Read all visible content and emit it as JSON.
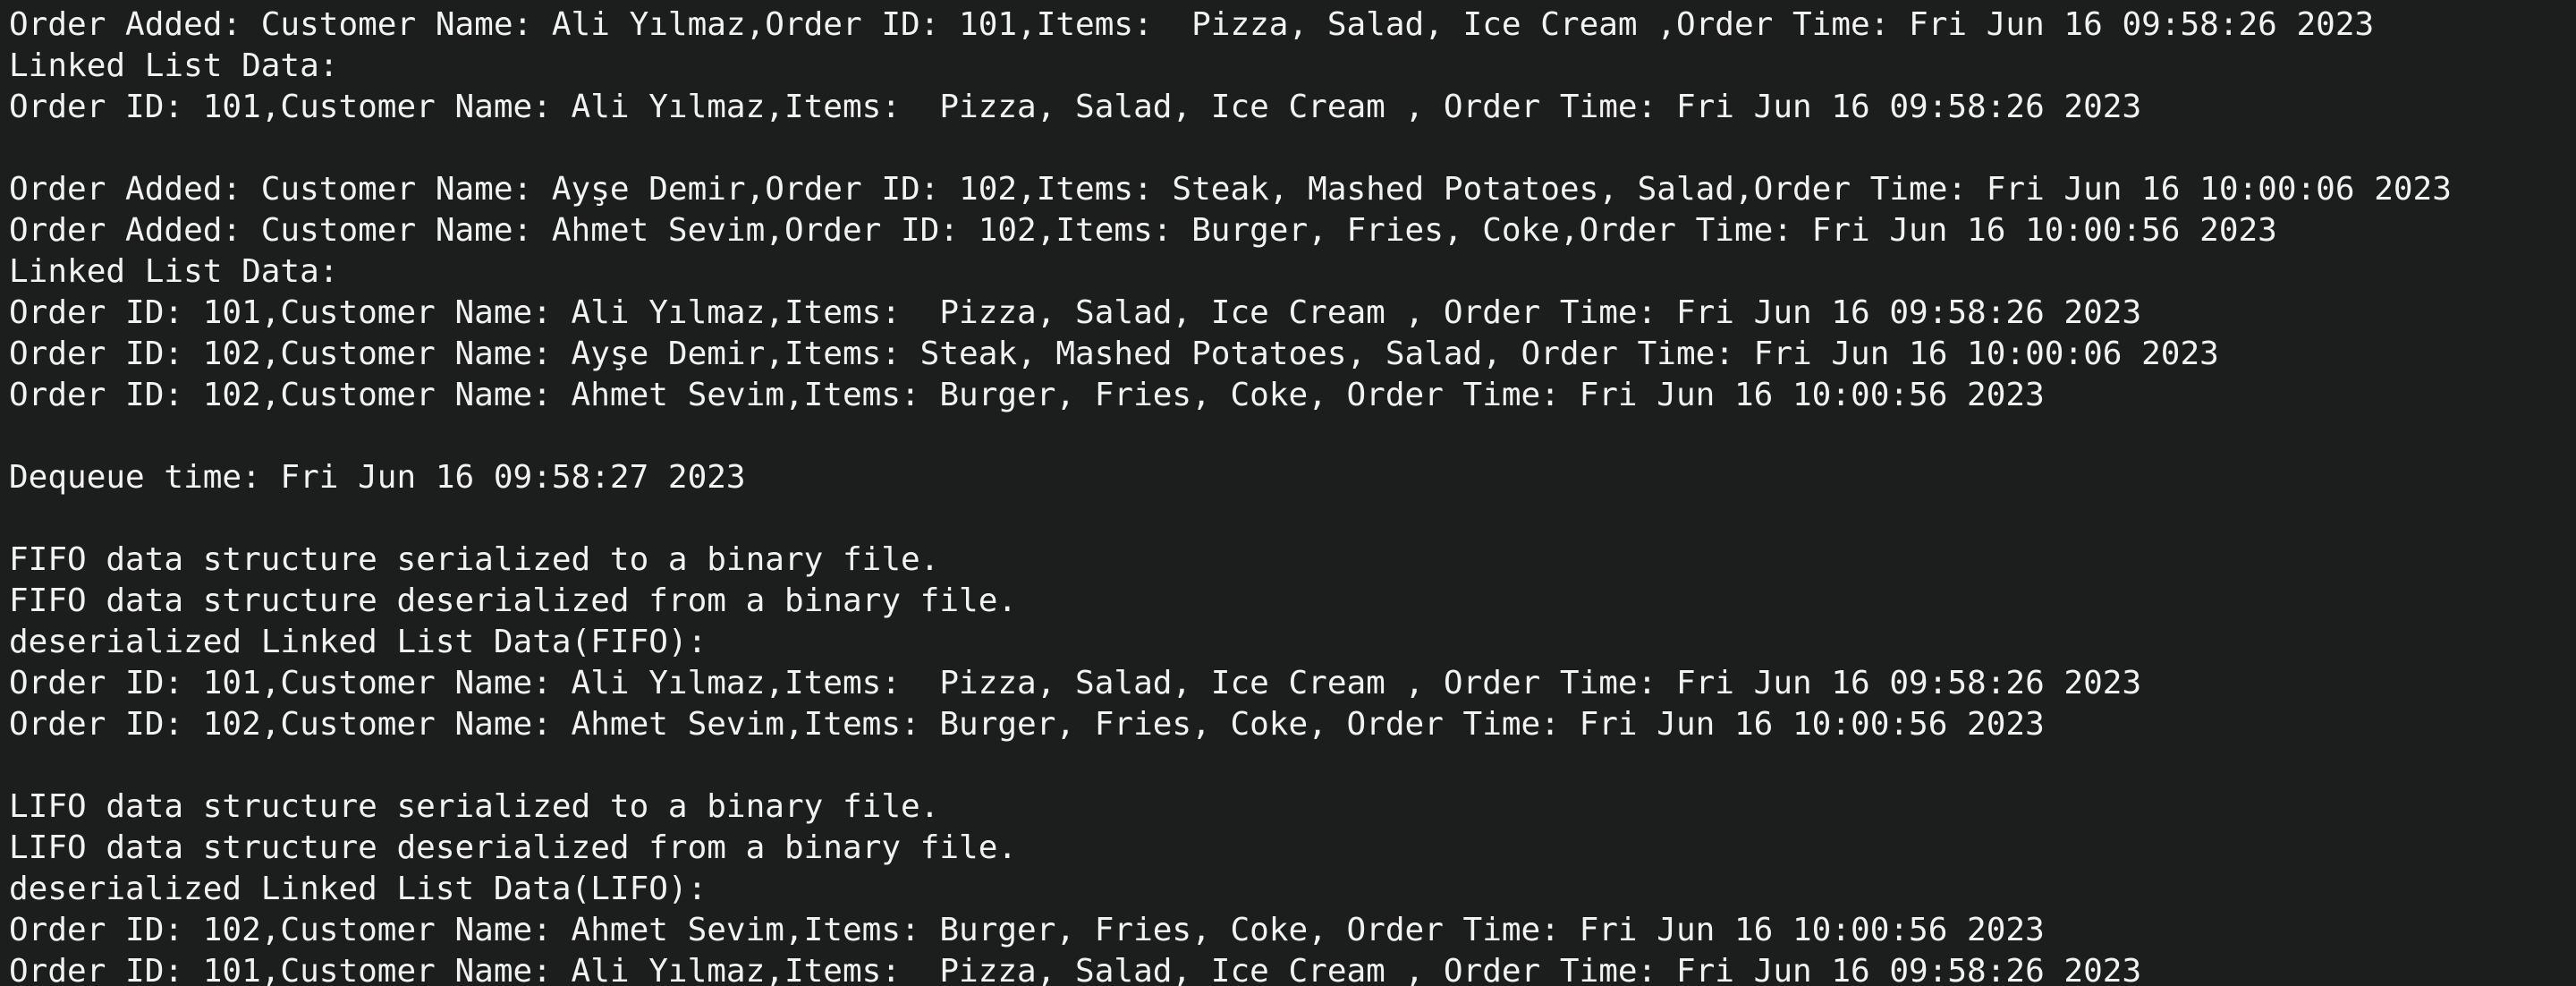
{
  "terminal": {
    "text_color": "#f2f2f2",
    "background_color": "#1c1e1d",
    "lines": [
      "Order Added: Customer Name: Ali Yılmaz,Order ID: 101,Items:  Pizza, Salad, Ice Cream ,Order Time: Fri Jun 16 09:58:26 2023",
      "Linked List Data:",
      "Order ID: 101,Customer Name: Ali Yılmaz,Items:  Pizza, Salad, Ice Cream , Order Time: Fri Jun 16 09:58:26 2023",
      "",
      "Order Added: Customer Name: Ayşe Demir,Order ID: 102,Items: Steak, Mashed Potatoes, Salad,Order Time: Fri Jun 16 10:00:06 2023",
      "Order Added: Customer Name: Ahmet Sevim,Order ID: 102,Items: Burger, Fries, Coke,Order Time: Fri Jun 16 10:00:56 2023",
      "Linked List Data:",
      "Order ID: 101,Customer Name: Ali Yılmaz,Items:  Pizza, Salad, Ice Cream , Order Time: Fri Jun 16 09:58:26 2023",
      "Order ID: 102,Customer Name: Ayşe Demir,Items: Steak, Mashed Potatoes, Salad, Order Time: Fri Jun 16 10:00:06 2023",
      "Order ID: 102,Customer Name: Ahmet Sevim,Items: Burger, Fries, Coke, Order Time: Fri Jun 16 10:00:56 2023",
      "",
      "Dequeue time: Fri Jun 16 09:58:27 2023",
      "",
      "FIFO data structure serialized to a binary file.",
      "FIFO data structure deserialized from a binary file.",
      "deserialized Linked List Data(FIFO):",
      "Order ID: 101,Customer Name: Ali Yılmaz,Items:  Pizza, Salad, Ice Cream , Order Time: Fri Jun 16 09:58:26 2023",
      "Order ID: 102,Customer Name: Ahmet Sevim,Items: Burger, Fries, Coke, Order Time: Fri Jun 16 10:00:56 2023",
      "",
      "LIFO data structure serialized to a binary file.",
      "LIFO data structure deserialized from a binary file.",
      "deserialized Linked List Data(LIFO):",
      "Order ID: 102,Customer Name: Ahmet Sevim,Items: Burger, Fries, Coke, Order Time: Fri Jun 16 10:00:56 2023",
      "Order ID: 101,Customer Name: Ali Yılmaz,Items:  Pizza, Salad, Ice Cream , Order Time: Fri Jun 16 09:58:26 2023"
    ]
  }
}
